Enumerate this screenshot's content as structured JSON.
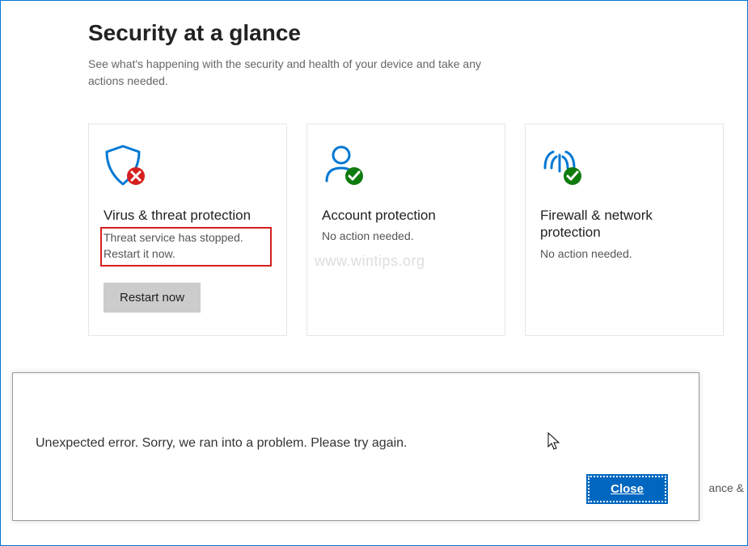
{
  "header": {
    "title": "Security at a glance",
    "subtitle": "See what's happening with the security and health of your device and take any actions needed."
  },
  "tiles": [
    {
      "title": "Virus & threat protection",
      "status": "Threat service has stopped. Restart it now.",
      "action_label": "Restart now",
      "badge": "error"
    },
    {
      "title": "Account protection",
      "status": "No action needed.",
      "badge": "ok"
    },
    {
      "title": "Firewall & network protection",
      "status": "No action needed.",
      "badge": "ok"
    }
  ],
  "dialog": {
    "message": "Unexpected error. Sorry, we ran into a problem.  Please try again.",
    "close_label": "Close"
  },
  "watermark": "www.wintips.org",
  "peek": "ance &"
}
